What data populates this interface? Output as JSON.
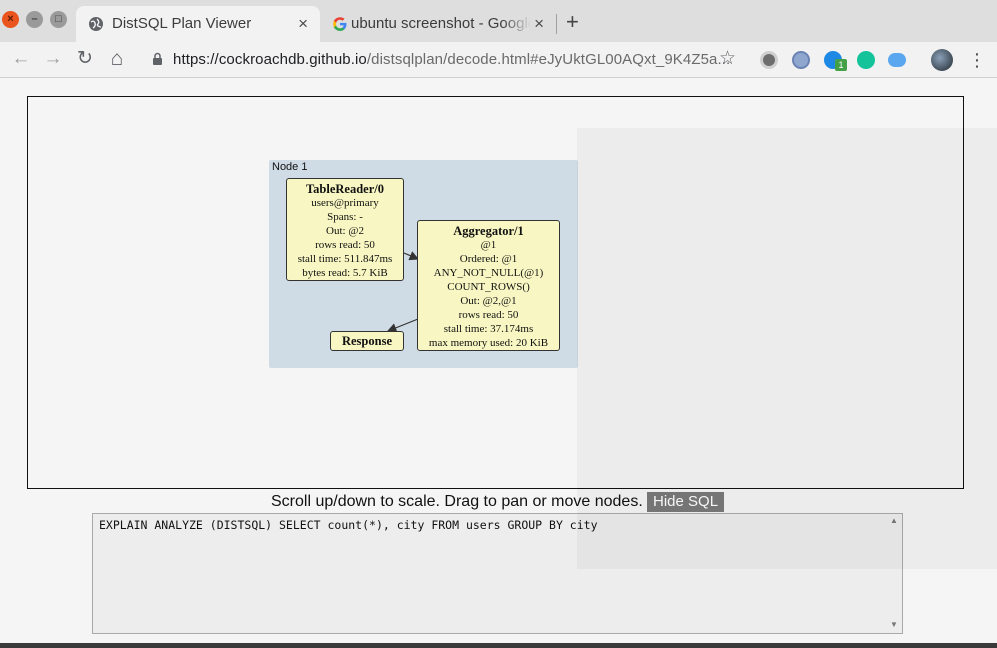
{
  "window": {
    "controls": {
      "close": "×",
      "minimize": "–",
      "maximize": "□"
    }
  },
  "tabs": [
    {
      "title": "DistSQL Plan Viewer",
      "close": "×",
      "favicon": "globe-icon"
    },
    {
      "title": "ubuntu screenshot - Google Search",
      "close": "×",
      "favicon": "google-g-icon"
    }
  ],
  "new_tab_label": "+",
  "toolbar": {
    "back": "←",
    "forward": "→",
    "reload": "↻",
    "home": "⌂",
    "url_host": "https://cockroachdb.github.io",
    "url_rest": "/distsqlplan/decode.html#eJyUktGL00AQxt_9K4Z5a...",
    "star": "☆",
    "extensions": [
      "ext-gray-icon",
      "ext-blue-icon",
      "ext-badge-icon",
      "grammarly-icon",
      "cloud-icon"
    ],
    "extension_badge": "1",
    "menu": "⋮"
  },
  "colors": {
    "cluster_bg": "#cfdbe5",
    "node_bg": "#f8f7c3",
    "button_bg": "#7a7a7a"
  },
  "plan": {
    "cluster_label": "Node 1",
    "table_reader": {
      "title": "TableReader/0",
      "lines": [
        "users@primary",
        "Spans: -",
        "Out: @2",
        "rows read: 50",
        "stall time: 511.847ms",
        "bytes read: 5.7 KiB"
      ]
    },
    "aggregator": {
      "title": "Aggregator/1",
      "lines": [
        "@1",
        "Ordered: @1",
        "ANY_NOT_NULL(@1)",
        "COUNT_ROWS()",
        "Out: @2,@1",
        "rows read: 50",
        "stall time: 37.174ms",
        "max memory used: 20 KiB"
      ]
    },
    "response": {
      "title": "Response"
    }
  },
  "controls": {
    "hint": "Scroll up/down to scale. Drag to pan or move nodes.",
    "hide_sql": "Hide SQL"
  },
  "sql": "EXPLAIN ANALYZE (DISTSQL) SELECT count(*), city FROM users GROUP BY city"
}
